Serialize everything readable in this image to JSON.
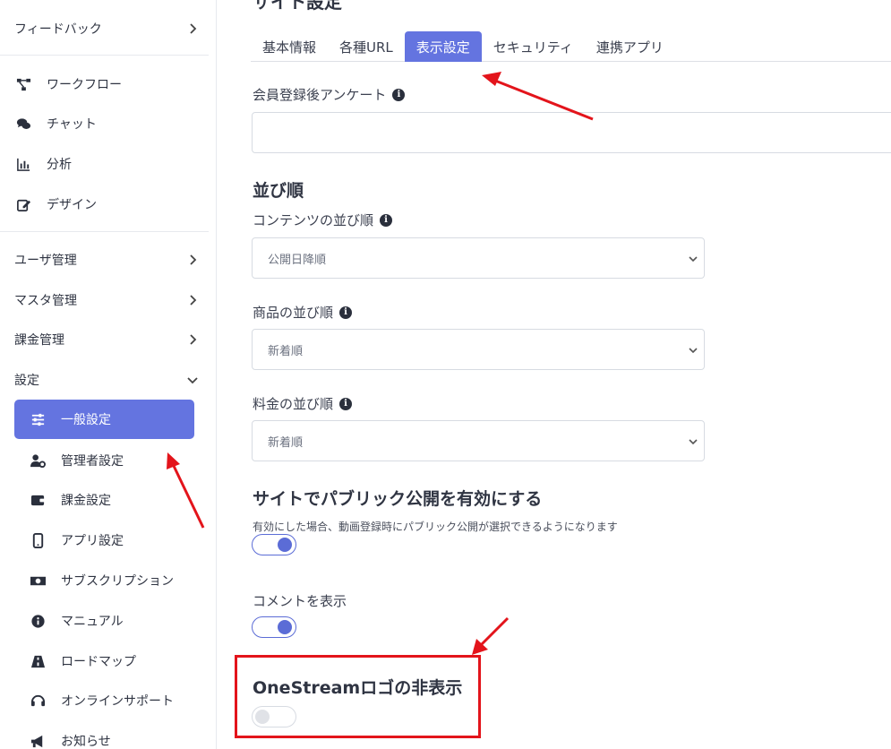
{
  "sidebar": {
    "top_items": [
      {
        "label": "フィードバック",
        "has_chevron": true
      }
    ],
    "tool_items": [
      {
        "label": "ワークフロー",
        "icon": "workflow-icon"
      },
      {
        "label": "チャット",
        "icon": "chat-icon"
      },
      {
        "label": "分析",
        "icon": "chart-icon"
      },
      {
        "label": "デザイン",
        "icon": "edit-icon"
      }
    ],
    "manage_items": [
      {
        "label": "ユーザ管理"
      },
      {
        "label": "マスタ管理"
      },
      {
        "label": "課金管理"
      }
    ],
    "settings": {
      "label": "設定",
      "items": [
        {
          "label": "一般設定",
          "icon": "sliders-icon",
          "active": true
        },
        {
          "label": "管理者設定",
          "icon": "user-gear-icon"
        },
        {
          "label": "課金設定",
          "icon": "wallet-icon"
        },
        {
          "label": "アプリ設定",
          "icon": "mobile-icon"
        },
        {
          "label": "サブスクリプション",
          "icon": "money-icon"
        },
        {
          "label": "マニュアル",
          "icon": "info-icon"
        },
        {
          "label": "ロードマップ",
          "icon": "road-icon"
        },
        {
          "label": "オンラインサポート",
          "icon": "headset-icon"
        },
        {
          "label": "お知らせ",
          "icon": "megaphone-icon"
        }
      ]
    }
  },
  "main": {
    "heading": "サイト設定",
    "tabs": [
      {
        "label": "基本情報",
        "active": false
      },
      {
        "label": "各種URL",
        "active": false
      },
      {
        "label": "表示設定",
        "active": true
      },
      {
        "label": "セキュリティ",
        "active": false
      },
      {
        "label": "連携アプリ",
        "active": false
      }
    ],
    "survey": {
      "label": "会員登録後アンケート",
      "value": ""
    },
    "sort_section": {
      "title": "並び順",
      "content_sort": {
        "label": "コンテンツの並び順",
        "selected": "公開日降順"
      },
      "product_sort": {
        "label": "商品の並び順",
        "selected": "新着順"
      },
      "price_sort": {
        "label": "料金の並び順",
        "selected": "新着順"
      }
    },
    "public_section": {
      "title": "サイトでパブリック公開を有効にする",
      "help": "有効にした場合、動画登録時にパブリック公開が選択できるようになります",
      "enabled": true
    },
    "comments": {
      "label": "コメントを表示",
      "enabled": true
    },
    "hide_logo": {
      "label": "OneStreamロゴの非表示",
      "enabled": false
    }
  },
  "colors": {
    "accent": "#6474e0",
    "annotation": "#e3141b"
  }
}
